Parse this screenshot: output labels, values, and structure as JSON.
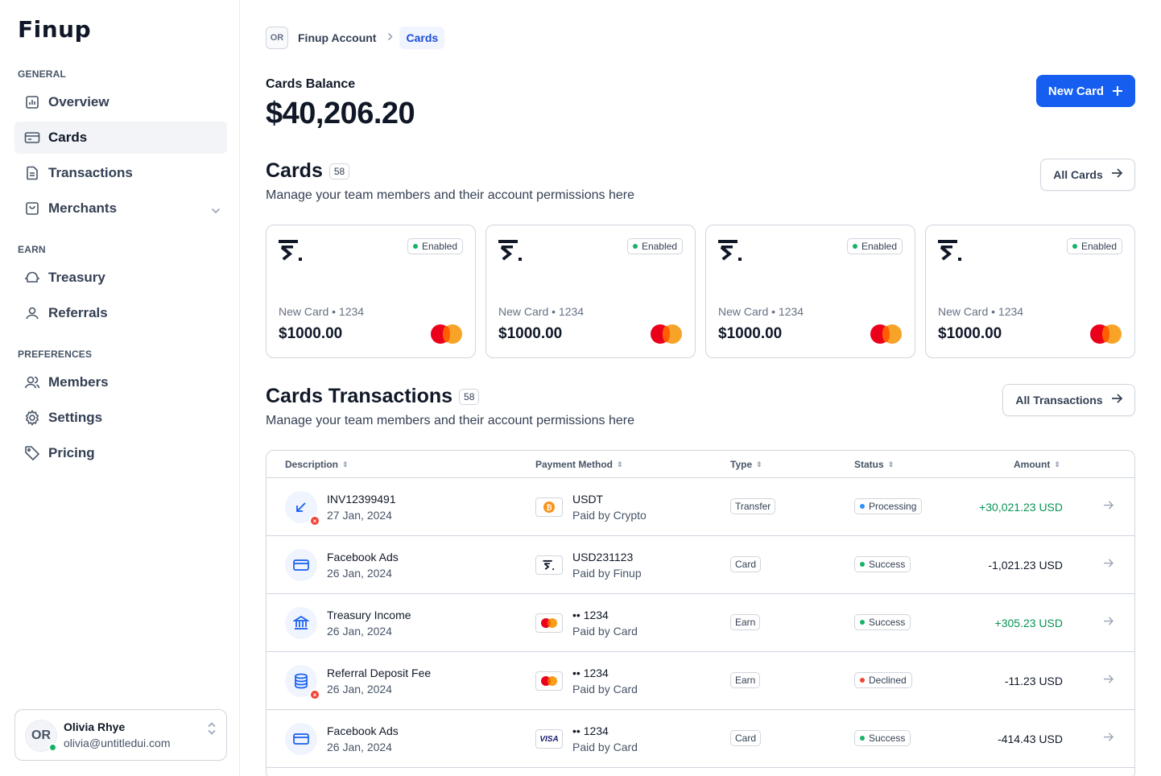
{
  "app": {
    "logo": "Finup"
  },
  "sidebar": {
    "sections": {
      "general": "GENERAL",
      "earn": "EARN",
      "preferences": "PREFERENCES"
    },
    "items": [
      {
        "label": "Overview",
        "icon": "bar-chart-icon"
      },
      {
        "label": "Cards",
        "icon": "credit-card-icon",
        "active": true
      },
      {
        "label": "Transactions",
        "icon": "file-text-icon"
      },
      {
        "label": "Merchants",
        "icon": "shopping-bag-icon"
      },
      {
        "label": "Treasury",
        "icon": "building-icon"
      },
      {
        "label": "Referrals",
        "icon": "user-icon"
      },
      {
        "label": "Members",
        "icon": "users-icon"
      },
      {
        "label": "Settings",
        "icon": "gear-icon"
      },
      {
        "label": "Pricing",
        "icon": "tag-icon"
      }
    ],
    "user": {
      "initials": "OR",
      "name": "Olivia Rhye",
      "email": "olivia@untitledui.com"
    }
  },
  "breadcrumb": {
    "initials": "OR",
    "account": "Finup Account",
    "current": "Cards"
  },
  "balance": {
    "label": "Cards Balance",
    "value": "$40,206.20"
  },
  "new_card_label": "New Card",
  "cards_section": {
    "title": "Cards",
    "count": "58",
    "subtitle": "Manage your team members and their account permissions here",
    "button": "All Cards",
    "cards": [
      {
        "status": "Enabled",
        "name": "New Card • 1234",
        "amount": "$1000.00"
      },
      {
        "status": "Enabled",
        "name": "New Card • 1234",
        "amount": "$1000.00"
      },
      {
        "status": "Enabled",
        "name": "New Card • 1234",
        "amount": "$1000.00"
      },
      {
        "status": "Enabled",
        "name": "New Card • 1234",
        "amount": "$1000.00"
      }
    ]
  },
  "tx_section": {
    "title": "Cards Transactions",
    "count": "58",
    "subtitle": "Manage your team members and their account permissions here",
    "button": "All Transactions",
    "columns": {
      "description": "Description",
      "payment": "Payment Method",
      "type": "Type",
      "status": "Status",
      "amount": "Amount"
    },
    "rows": [
      {
        "title": "INV12399491",
        "date": "27 Jan, 2024",
        "pm_title": "USDT",
        "pm_sub": "Paid by Crypto",
        "type": "Transfer",
        "status": "Processing",
        "amount": "+30,021.23 USD"
      },
      {
        "title": "Facebook Ads",
        "date": "26 Jan, 2024",
        "pm_title": "USD231123",
        "pm_sub": "Paid by Finup",
        "type": "Card",
        "status": "Success",
        "amount": "-1,021.23 USD"
      },
      {
        "title": "Treasury Income",
        "date": "26 Jan, 2024",
        "pm_title": "•• 1234",
        "pm_sub": "Paid by Card",
        "type": "Earn",
        "status": "Success",
        "amount": "+305.23 USD"
      },
      {
        "title": "Referral Deposit Fee",
        "date": "26 Jan, 2024",
        "pm_title": "•• 1234",
        "pm_sub": "Paid by Card",
        "type": "Earn",
        "status": "Declined",
        "amount": "-11.23 USD"
      },
      {
        "title": "Facebook Ads",
        "date": "26 Jan, 2024",
        "pm_title": "•• 1234",
        "pm_sub": "Paid by Card",
        "type": "Card",
        "status": "Success",
        "amount": "-414.43 USD"
      }
    ],
    "visa_label": "VISA"
  },
  "colors": {
    "primary": "#155EEF",
    "success": "#17B26A",
    "processing": "#2E90FA",
    "declined": "#F04438",
    "positive_amount": "#079455"
  }
}
